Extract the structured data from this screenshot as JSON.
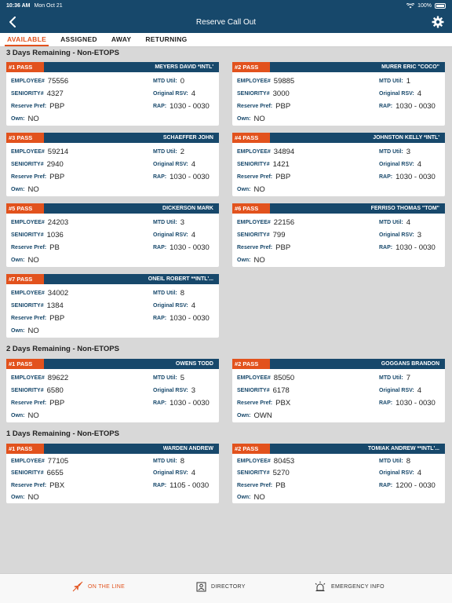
{
  "status": {
    "time": "10:36 AM",
    "date": "Mon Oct 21",
    "battery": "100%"
  },
  "nav": {
    "title": "Reserve Call Out"
  },
  "tabs": [
    "AVAILABLE",
    "ASSIGNED",
    "AWAY",
    "RETURNING"
  ],
  "labels": {
    "employee": "EMPLOYEE#",
    "seniority": "SENIORITY#",
    "reserve_pref": "Reserve Pref:",
    "own": "Own:",
    "mtd_util": "MTD Util:",
    "original_rsv": "Original RSV:",
    "rap": "RAP:"
  },
  "sections": [
    {
      "title": "3 Days Remaining - Non-ETOPS",
      "cards": [
        {
          "pass": "#1 PASS",
          "name": "MEYERS DAVID *INTL'",
          "employee": "75556",
          "seniority": "4327",
          "reserve_pref": "PBP",
          "own": "NO",
          "mtd_util": "0",
          "original_rsv": "4",
          "rap": "1030 - 0030"
        },
        {
          "pass": "#2 PASS",
          "name": "MURER ERIC \"COCO\"",
          "employee": "59885",
          "seniority": "3000",
          "reserve_pref": "PBP",
          "own": "NO",
          "mtd_util": "1",
          "original_rsv": "4",
          "rap": "1030 - 0030"
        },
        {
          "pass": "#3 PASS",
          "name": "SCHAEFFER JOHN",
          "employee": "59214",
          "seniority": "2940",
          "reserve_pref": "PBP",
          "own": "NO",
          "mtd_util": "2",
          "original_rsv": "4",
          "rap": "1030 - 0030"
        },
        {
          "pass": "#4 PASS",
          "name": "JOHNSTON KELLY *INTL'",
          "employee": "34894",
          "seniority": "1421",
          "reserve_pref": "PBP",
          "own": "NO",
          "mtd_util": "3",
          "original_rsv": "4",
          "rap": "1030 - 0030"
        },
        {
          "pass": "#5 PASS",
          "name": "DICKERSON MARK",
          "employee": "24203",
          "seniority": "1036",
          "reserve_pref": "PB",
          "own": "NO",
          "mtd_util": "3",
          "original_rsv": "4",
          "rap": "1030 - 0030"
        },
        {
          "pass": "#6 PASS",
          "name": "FERRISO THOMAS \"TOM\"",
          "employee": "22156",
          "seniority": "799",
          "reserve_pref": "PBP",
          "own": "NO",
          "mtd_util": "4",
          "original_rsv": "3",
          "rap": "1030 - 0030"
        },
        {
          "pass": "#7 PASS",
          "name": "ONEIL ROBERT **INTL'...",
          "employee": "34002",
          "seniority": "1384",
          "reserve_pref": "PBP",
          "own": "NO",
          "mtd_util": "8",
          "original_rsv": "4",
          "rap": "1030 - 0030"
        }
      ]
    },
    {
      "title": "2 Days Remaining - Non-ETOPS",
      "cards": [
        {
          "pass": "#1 PASS",
          "name": "OWENS TODD",
          "employee": "89622",
          "seniority": "6580",
          "reserve_pref": "PBP",
          "own": "NO",
          "mtd_util": "5",
          "original_rsv": "3",
          "rap": "1030 - 0030"
        },
        {
          "pass": "#2 PASS",
          "name": "GOGGANS BRANDON",
          "employee": "85050",
          "seniority": "6178",
          "reserve_pref": "PBX",
          "own": "OWN",
          "mtd_util": "7",
          "original_rsv": "4",
          "rap": "1030 - 0030"
        }
      ]
    },
    {
      "title": "1 Days Remaining - Non-ETOPS",
      "cards": [
        {
          "pass": "#1 PASS",
          "name": "WARDEN ANDREW",
          "employee": "77105",
          "seniority": "6655",
          "reserve_pref": "PBX",
          "own": "NO",
          "mtd_util": "8",
          "original_rsv": "4",
          "rap": "1105 - 0030"
        },
        {
          "pass": "#2 PASS",
          "name": "TOMIAK ANDREW **INTL'...",
          "employee": "80453",
          "seniority": "5270",
          "reserve_pref": "PB",
          "own": "NO",
          "mtd_util": "8",
          "original_rsv": "4",
          "rap": "1200 - 0030"
        }
      ]
    }
  ],
  "bottom_tabs": [
    {
      "label": "ON THE LINE",
      "icon": "plane-icon"
    },
    {
      "label": "DIRECTORY",
      "icon": "contact-card-icon"
    },
    {
      "label": "EMERGENCY INFO",
      "icon": "alarm-light-icon"
    }
  ],
  "colors": {
    "primary": "#17486b",
    "accent": "#e2521d",
    "background": "#d8d8d8"
  }
}
